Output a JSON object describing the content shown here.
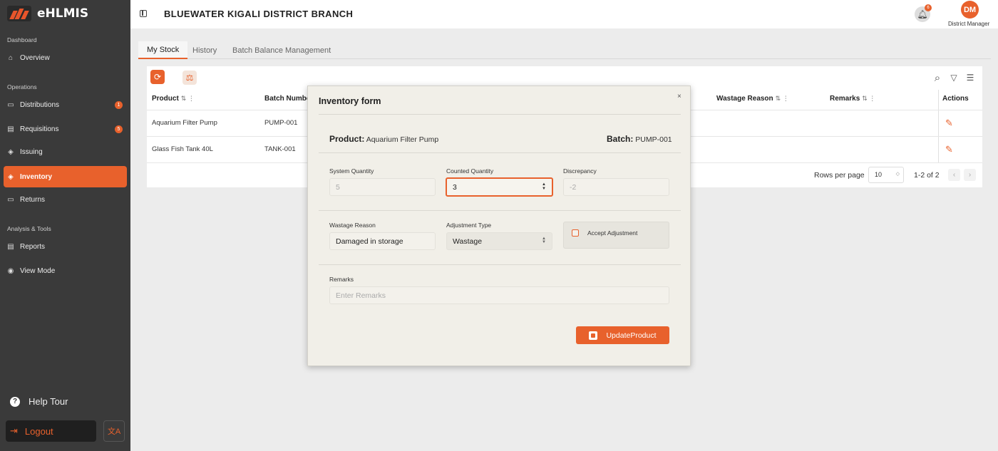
{
  "app": {
    "name": "eHLMIS"
  },
  "sidebar": {
    "sections": [
      "Dashboard",
      "Operations",
      "Analysis & Tools"
    ],
    "items": [
      {
        "label": "Overview",
        "icon": "home-icon"
      },
      {
        "label": "Distributions",
        "icon": "truck-icon",
        "badge": "1"
      },
      {
        "label": "Requisitions",
        "icon": "document-icon",
        "badge": "5"
      },
      {
        "label": "Issuing",
        "icon": "box-icon"
      },
      {
        "label": "Inventory",
        "icon": "box-icon",
        "active": true
      },
      {
        "label": "Returns",
        "icon": "truck-icon"
      },
      {
        "label": "Reports",
        "icon": "document-icon"
      },
      {
        "label": "View Mode",
        "icon": "eye-icon"
      }
    ],
    "help_label": "Help Tour",
    "logout_label": "Logout"
  },
  "header": {
    "branch": "BLUEWATER KIGALI DISTRICT BRANCH",
    "notification_count": "6",
    "avatar_initials": "DM",
    "role": "District Manager"
  },
  "tabs": [
    "My Stock",
    "History",
    "Batch Balance Management"
  ],
  "table": {
    "columns": [
      "Product",
      "Batch Number",
      "Wastage Reason",
      "Remarks",
      "Actions"
    ],
    "rows": [
      {
        "product": "Aquarium Filter Pump",
        "batch": "PUMP-001"
      },
      {
        "product": "Glass Fish Tank 40L",
        "batch": "TANK-001"
      }
    ],
    "rows_per_page_label": "Rows per page",
    "rows_per_page": "10",
    "page_range": "1-2 of 2"
  },
  "modal": {
    "title": "Inventory form",
    "close": "×",
    "product_label": "Product:",
    "product_value": "Aquarium Filter Pump",
    "batch_label": "Batch:",
    "batch_value": "PUMP-001",
    "system_quantity_label": "System Quantity",
    "system_quantity": "5",
    "counted_quantity_label": "Counted Quantity",
    "counted_quantity": "3",
    "discrepancy_label": "Discrepancy",
    "discrepancy": "-2",
    "wastage_reason_label": "Wastage Reason",
    "wastage_reason": "Damaged in storage",
    "adjustment_type_label": "Adjustment Type",
    "adjustment_type": "Wastage",
    "accept_label": "Accept Adjustment",
    "remarks_label": "Remarks",
    "remarks_placeholder": "Enter Remarks",
    "submit_label": "UpdateProduct"
  },
  "colors": {
    "accent": "#e8612c",
    "sidebar": "#3a3a3a"
  }
}
